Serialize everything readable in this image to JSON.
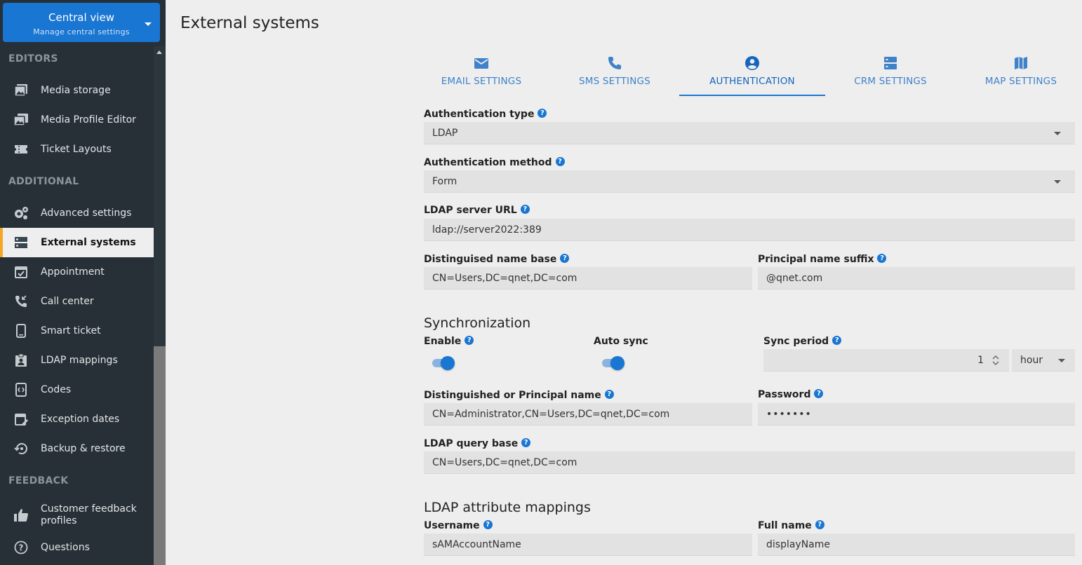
{
  "central": {
    "title": "Central view",
    "subtitle": "Manage central settings"
  },
  "sidebar": {
    "sections": {
      "editors": "EDITORS",
      "additional": "ADDITIONAL",
      "feedback": "FEEDBACK"
    },
    "items": [
      {
        "label": "Media storage",
        "icon": "image-icon"
      },
      {
        "label": "Media Profile Editor",
        "icon": "images-icon"
      },
      {
        "label": "Ticket Layouts",
        "icon": "ticket-icon"
      },
      {
        "label": "Advanced settings",
        "icon": "gears-icon"
      },
      {
        "label": "External systems",
        "icon": "server-icon",
        "active": true
      },
      {
        "label": "Appointment",
        "icon": "calendar-check-icon"
      },
      {
        "label": "Call center",
        "icon": "phone-incoming-icon"
      },
      {
        "label": "Smart ticket",
        "icon": "smartphone-icon"
      },
      {
        "label": "LDAP mappings",
        "icon": "badge-icon"
      },
      {
        "label": "Codes",
        "icon": "code-icon"
      },
      {
        "label": "Exception dates",
        "icon": "calendar-edit-icon"
      },
      {
        "label": "Backup & restore",
        "icon": "restore-icon"
      },
      {
        "label": "Customer feedback profiles",
        "icon": "thumbs-up-icon"
      },
      {
        "label": "Questions",
        "icon": "question-icon"
      }
    ]
  },
  "page": {
    "title": "External systems"
  },
  "tabs": [
    {
      "label": "EMAIL SETTINGS",
      "icon": "envelope-icon"
    },
    {
      "label": "SMS SETTINGS",
      "icon": "phone-icon"
    },
    {
      "label": "AUTHENTICATION",
      "icon": "account-circle-icon",
      "active": true
    },
    {
      "label": "CRM SETTINGS",
      "icon": "server-icon"
    },
    {
      "label": "MAP SETTINGS",
      "icon": "map-icon"
    }
  ],
  "form": {
    "auth_type": {
      "label": "Authentication type",
      "value": "LDAP"
    },
    "auth_method": {
      "label": "Authentication method",
      "value": "Form"
    },
    "ldap_url": {
      "label": "LDAP server URL",
      "value": "ldap://server2022:389"
    },
    "dn_base": {
      "label": "Distinguised name base",
      "value": "CN=Users,DC=qnet,DC=com"
    },
    "principal_suffix": {
      "label": "Principal name suffix",
      "value": "@qnet.com"
    },
    "sync": {
      "heading": "Synchronization",
      "enable_label": "Enable",
      "enable_on": true,
      "auto_sync_label": "Auto sync",
      "auto_sync_on": true,
      "period_label": "Sync period",
      "period_value": "1",
      "period_unit": "hour"
    },
    "dn_principal": {
      "label": "Distinguished or Principal name",
      "value": "CN=Administrator,CN=Users,DC=qnet,DC=com"
    },
    "password": {
      "label": "Password",
      "value": "•••••••"
    },
    "query_base": {
      "label": "LDAP query base",
      "value": "CN=Users,DC=qnet,DC=com"
    },
    "mappings": {
      "heading": "LDAP attribute mappings",
      "username_label": "Username",
      "username_value": "sAMAccountName",
      "fullname_label": "Full name",
      "fullname_value": "displayName"
    }
  },
  "colors": {
    "accent": "#1976d2",
    "sidebar": "#263036",
    "active_marker": "#f5a623",
    "field_bg": "#e2e2e2"
  }
}
